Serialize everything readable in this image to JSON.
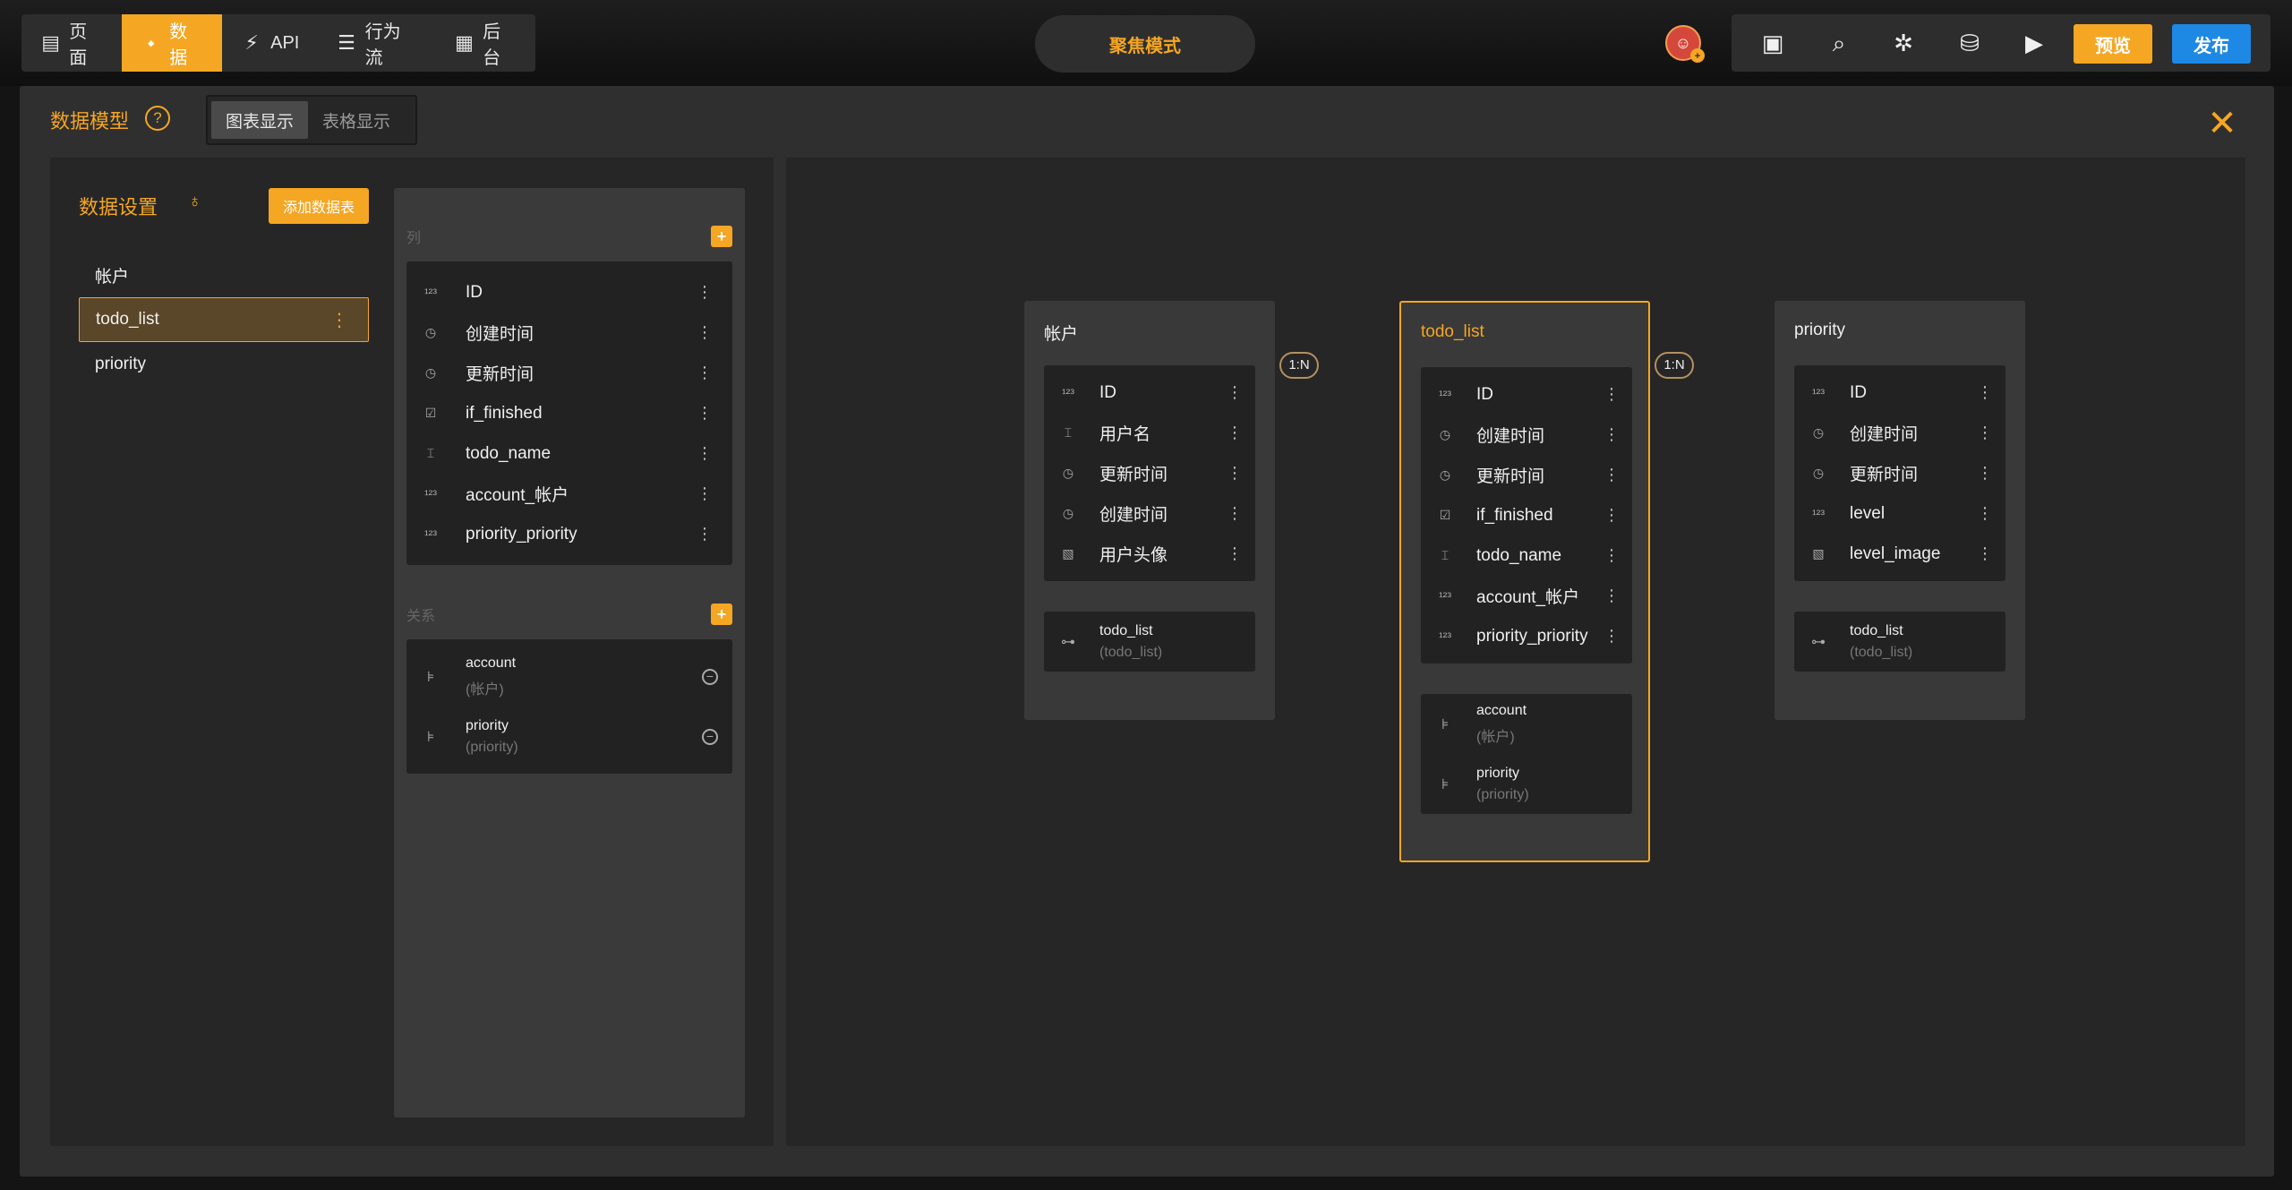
{
  "topbar": {
    "nav": [
      {
        "label": "页面",
        "icon": "page-icon"
      },
      {
        "label": "数据",
        "icon": "data-icon",
        "active": true
      },
      {
        "label": "API",
        "icon": "api-icon"
      },
      {
        "label": "行为流",
        "icon": "flow-icon"
      },
      {
        "label": "后台",
        "icon": "backend-icon"
      }
    ],
    "focus_mode": "聚焦模式",
    "preview": "预览",
    "publish": "发布"
  },
  "modal": {
    "title": "数据模型",
    "view_tabs": [
      "图表显示",
      "表格显示"
    ],
    "active_view": "图表显示"
  },
  "left": {
    "heading": "数据设置",
    "add_table": "添加数据表",
    "tables": [
      "帐户",
      "todo_list",
      "priority"
    ],
    "selected": "todo_list",
    "columns_label": "列",
    "relations_label": "关系",
    "columns": [
      {
        "name": "ID",
        "icon": "number-icon"
      },
      {
        "name": "创建时间",
        "icon": "clock-icon"
      },
      {
        "name": "更新时间",
        "icon": "clock-icon"
      },
      {
        "name": "if_finished",
        "icon": "checkbox-icon"
      },
      {
        "name": "todo_name",
        "icon": "text-icon"
      },
      {
        "name": "account_帐户",
        "icon": "number-icon"
      },
      {
        "name": "priority_priority",
        "icon": "number-icon"
      }
    ],
    "relations": [
      {
        "name": "account",
        "sub": "(帐户)"
      },
      {
        "name": "priority",
        "sub": "(priority)"
      }
    ]
  },
  "diagram": {
    "relations": [
      "1:N",
      "1:N"
    ],
    "tables": [
      {
        "title": "帐户",
        "fields": [
          {
            "name": "ID",
            "icon": "number-icon"
          },
          {
            "name": "用户名",
            "icon": "text-icon"
          },
          {
            "name": "更新时间",
            "icon": "clock-icon"
          },
          {
            "name": "创建时间",
            "icon": "clock-icon"
          },
          {
            "name": "用户头像",
            "icon": "image-icon"
          }
        ],
        "relations": [
          {
            "name": "todo_list",
            "sub": "(todo_list)"
          }
        ]
      },
      {
        "title": "todo_list",
        "fields": [
          {
            "name": "ID",
            "icon": "number-icon"
          },
          {
            "name": "创建时间",
            "icon": "clock-icon"
          },
          {
            "name": "更新时间",
            "icon": "clock-icon"
          },
          {
            "name": "if_finished",
            "icon": "checkbox-icon"
          },
          {
            "name": "todo_name",
            "icon": "text-icon"
          },
          {
            "name": "account_帐户",
            "icon": "number-icon"
          },
          {
            "name": "priority_priority",
            "icon": "number-icon"
          }
        ],
        "relations": [
          {
            "name": "account",
            "sub": "(帐户)"
          },
          {
            "name": "priority",
            "sub": "(priority)"
          }
        ]
      },
      {
        "title": "priority",
        "fields": [
          {
            "name": "ID",
            "icon": "number-icon"
          },
          {
            "name": "创建时间",
            "icon": "clock-icon"
          },
          {
            "name": "更新时间",
            "icon": "clock-icon"
          },
          {
            "name": "level",
            "icon": "number-icon"
          },
          {
            "name": "level_image",
            "icon": "image-icon"
          }
        ],
        "relations": [
          {
            "name": "todo_list",
            "sub": "(todo_list)"
          }
        ]
      }
    ]
  },
  "colors": {
    "accent": "#f5a623",
    "publish": "#1e88e5",
    "panel": "#262626"
  }
}
